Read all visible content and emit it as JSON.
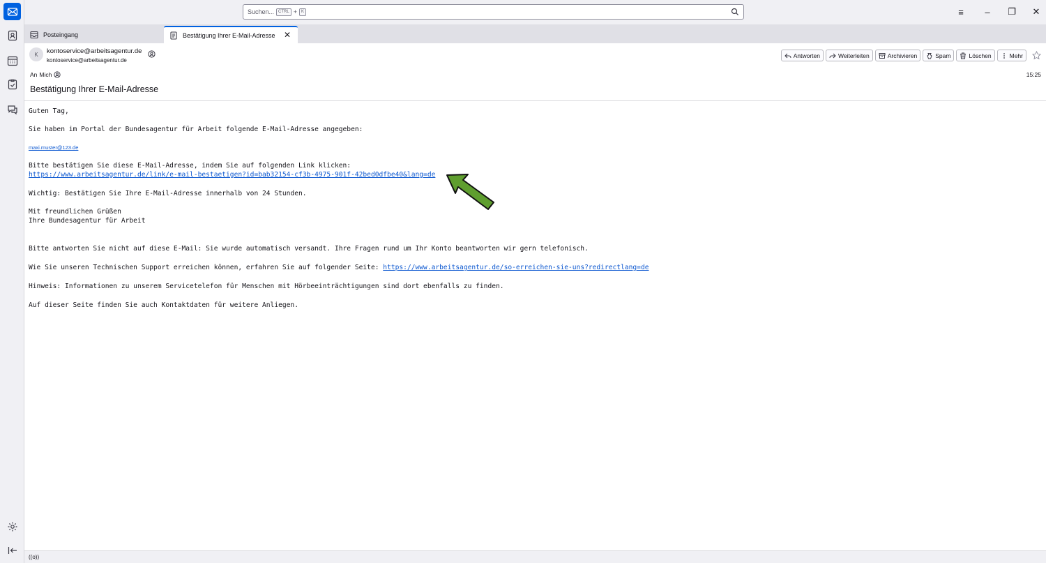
{
  "app": {
    "search_placeholder": "Suchen...",
    "shortcut_key1": "CTRL",
    "shortcut_plus": "+",
    "shortcut_key2": "K"
  },
  "window_controls": {
    "menu": "≡",
    "minimize": "–",
    "restore": "❐",
    "close": "✕"
  },
  "tabs": [
    {
      "label": "Posteingang",
      "icon": "inbox-icon"
    },
    {
      "label": "Bestätigung Ihrer E-Mail-Adresse",
      "icon": "message-icon",
      "close": "✕"
    }
  ],
  "message": {
    "avatar_letter": "K",
    "sender_name": "kontoservice@arbeitsagentur.de",
    "sender_email": "kontoservice@arbeitsagentur.de",
    "to_label": "An",
    "to_value": "Mich",
    "time": "15:25",
    "subject": "Bestätigung Ihrer E-Mail-Adresse",
    "actions": [
      {
        "label": "Antworten",
        "icon": "reply-icon"
      },
      {
        "label": "Weiterleiten",
        "icon": "forward-icon"
      },
      {
        "label": "Archivieren",
        "icon": "archive-icon"
      },
      {
        "label": "Spam",
        "icon": "spam-icon"
      },
      {
        "label": "Löschen",
        "icon": "trash-icon"
      },
      {
        "label": "Mehr",
        "icon": "more-icon"
      }
    ]
  },
  "body": {
    "greeting": "Guten Tag,",
    "intro": "Sie haben im Portal der Bundesagentur für Arbeit folgende E-Mail-Adresse angegeben:",
    "email_link": "maxi.muster@123.de",
    "confirm_text": "Bitte bestätigen Sie diese E-Mail-Adresse, indem Sie auf folgenden Link klicken:",
    "confirm_link": "https://www.arbeitsagentur.de/link/e-mail-bestaetigen?id=bab32154-cf3b-4975-901f-42bed0dfbe40&lang=de",
    "important": "Wichtig: Bestätigen Sie Ihre E-Mail-Adresse innerhalb von 24 Stunden.",
    "closing1": "Mit freundlichen Grüßen",
    "closing2": "Ihre Bundesagentur für Arbeit",
    "noreply": "Bitte antworten Sie nicht auf diese E-Mail: Sie wurde automatisch versandt. Ihre Fragen rund um Ihr Konto beantworten wir gern telefonisch.",
    "support_text": "Wie Sie unseren Technischen Support erreichen können, erfahren Sie auf folgender Seite: ",
    "support_link": "https://www.arbeitsagentur.de/so-erreichen-sie-uns?redirectlang=de",
    "hint": "Hinweis: Informationen zu unserem Servicetelefon für Menschen mit Hörbeeinträchtigungen sind dort ebenfalls zu finden.",
    "contact": "Auf dieser Seite finden Sie auch Kontaktdaten für weitere Anliegen."
  },
  "statusbar": {
    "text": "((o))"
  },
  "colors": {
    "accent": "#0061e0",
    "link": "#0b57d0",
    "arrow": "#5f9e2f"
  }
}
